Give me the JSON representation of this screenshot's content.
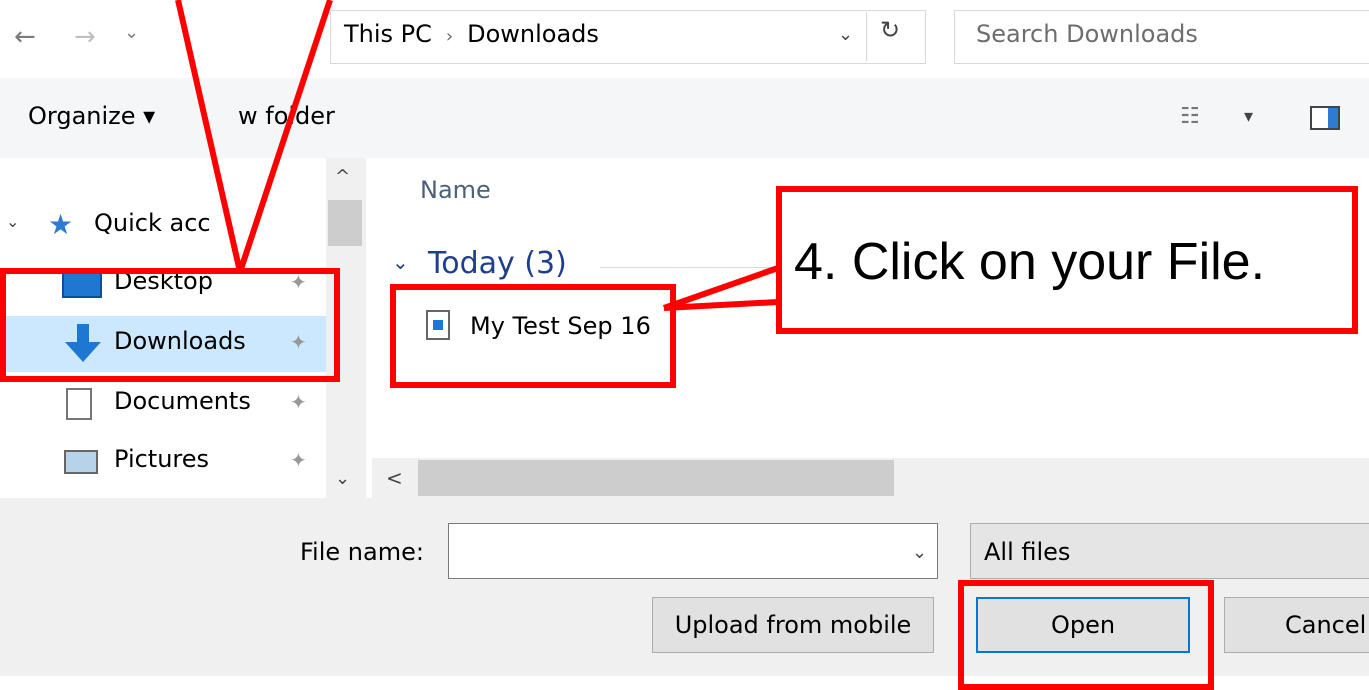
{
  "address": {
    "crumbs": [
      "This PC",
      "Downloads"
    ],
    "crumb_sep": "›",
    "dropdown_glyph": "⌄",
    "refresh_glyph": "↻",
    "search_placeholder": "Search Downloads"
  },
  "nav_arrows": {
    "back": "←",
    "forward": "→",
    "recent": "⌄"
  },
  "toolbar": {
    "organize_label": "Organize ▾",
    "new_folder_label": "New folder",
    "new_folder_visible": "w folder",
    "view_dd": "▾"
  },
  "nav_pane": {
    "items": [
      {
        "label": "Quick acc",
        "icon": "star-icon"
      },
      {
        "label": "Desktop",
        "icon": "desktop-icon"
      },
      {
        "label": "Downloads",
        "icon": "download-arrow-icon",
        "selected": true
      },
      {
        "label": "Documents",
        "icon": "document-icon"
      },
      {
        "label": "Pictures",
        "icon": "picture-icon"
      }
    ],
    "scroll_up": "^",
    "scroll_down": "⌄"
  },
  "file_pane": {
    "column_name": "Name",
    "group_header": "Today (3)",
    "files": [
      {
        "label": "My Test Sep 16",
        "icon": "file-icon"
      }
    ],
    "hscroll_left": "<"
  },
  "bottom": {
    "file_name_label": "File name:",
    "file_name_value": "",
    "file_type": "All files",
    "upload_button": "Upload from mobile",
    "open_button": "Open",
    "cancel_button": "Cancel"
  },
  "annotation": {
    "callout_text": "4. Click on your File.",
    "color": "#ff0000"
  }
}
